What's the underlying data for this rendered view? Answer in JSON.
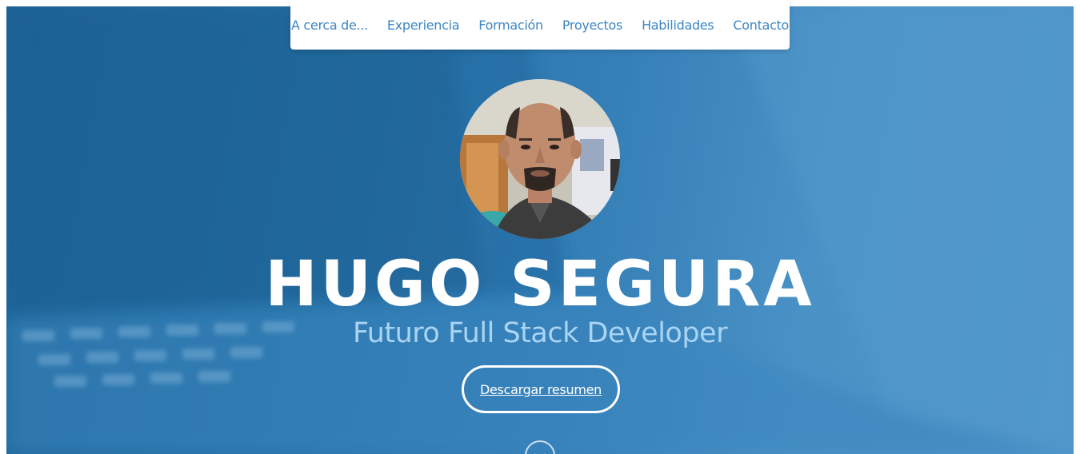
{
  "nav": {
    "items": [
      {
        "label": "A cerca de..."
      },
      {
        "label": "Experiencia"
      },
      {
        "label": "Formación"
      },
      {
        "label": "Proyectos"
      },
      {
        "label": "Habilidades"
      },
      {
        "label": "Contacto"
      }
    ]
  },
  "hero": {
    "name": "HUGO SEGURA",
    "subtitle": "Futuro Full Stack Developer",
    "cta_label": "Descargar resumen",
    "avatar_icon": "profile-photo",
    "scroll_icon": "chevron-down-circle-icon"
  },
  "colors": {
    "nav_text": "#3d86c2",
    "hero_bg": "#2a75ad",
    "subtitle": "#a9d4f4",
    "white": "#ffffff"
  }
}
